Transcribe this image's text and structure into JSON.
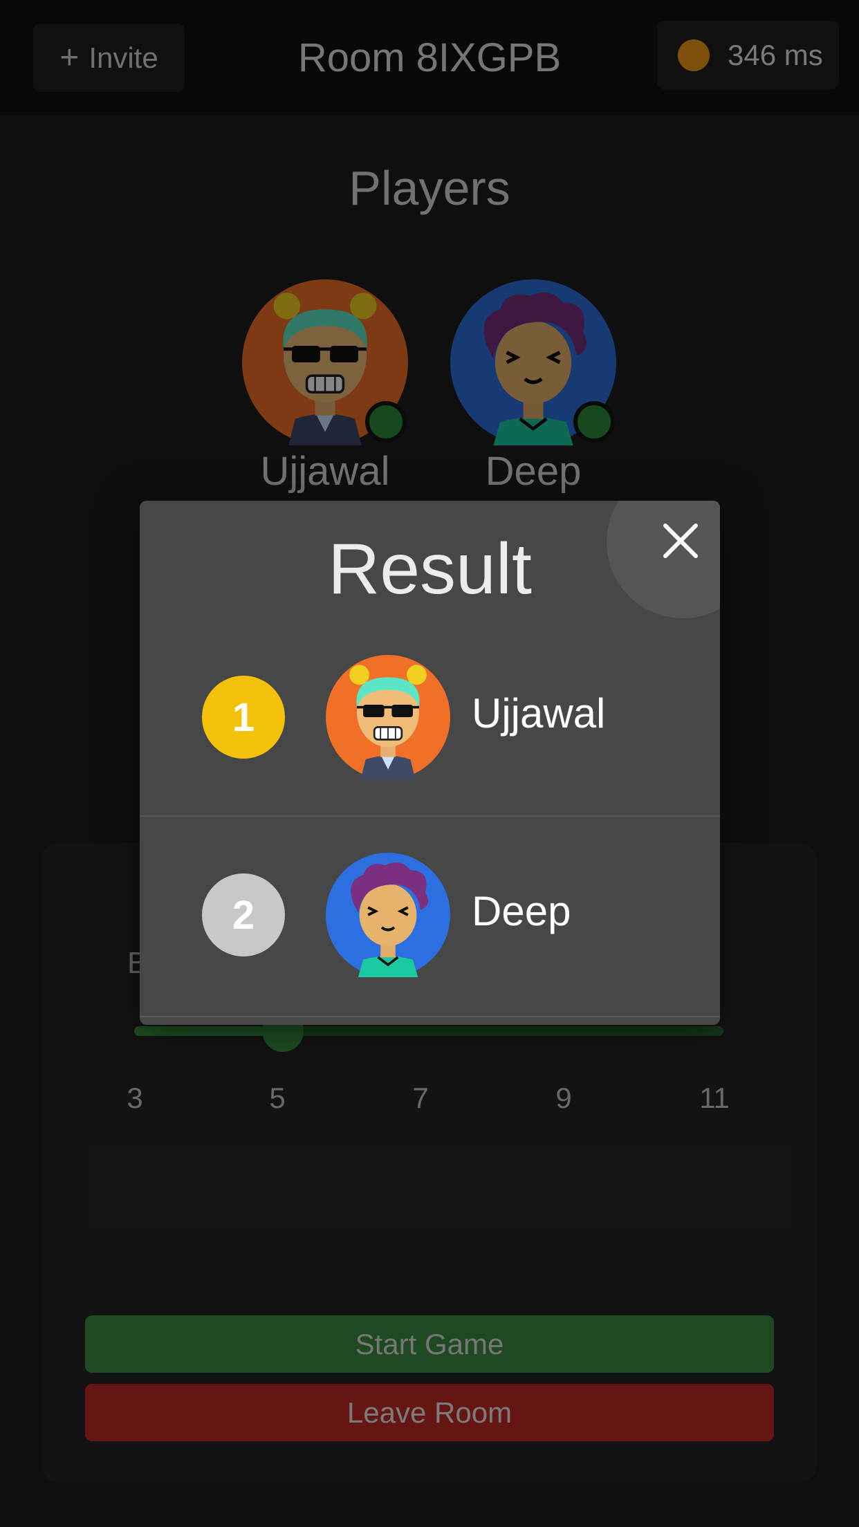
{
  "header": {
    "invite_label": "Invite",
    "room_title": "Room 8IXGPB",
    "ping_text": "346 ms",
    "ping_color": "#ef9a1a"
  },
  "lobby": {
    "players_title": "Players",
    "players": [
      {
        "name": "Ujjawal",
        "online": true,
        "avatar": "avatar-sunglasses-icon"
      },
      {
        "name": "Deep",
        "online": true,
        "avatar": "avatar-purple-hair-icon"
      }
    ],
    "setting_label_partial": "B",
    "slider": {
      "min": 3,
      "max": 11,
      "value": 5,
      "ticks": [
        "3",
        "5",
        "7",
        "9",
        "11"
      ]
    },
    "start_label": "Start Game",
    "leave_label": "Leave Room"
  },
  "modal": {
    "title": "Result",
    "close_icon": "close-icon",
    "results": [
      {
        "rank": "1",
        "name": "Ujjawal",
        "rank_color": "#f5c20b"
      },
      {
        "rank": "2",
        "name": "Deep",
        "rank_color": "#c8c8c8"
      }
    ]
  }
}
